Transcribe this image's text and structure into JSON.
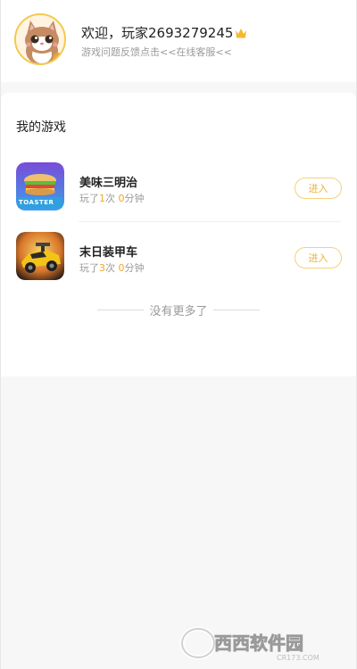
{
  "user": {
    "welcome_text": "欢迎，玩家2693279245",
    "feedback_text": "游戏问题反馈点击<<在线客服<<"
  },
  "my_games": {
    "title": "我的游戏",
    "items": [
      {
        "name": "美味三明治",
        "played_prefix": "玩了",
        "played_count": "1",
        "played_unit": "次",
        "minutes": "0",
        "minutes_unit": "分钟",
        "enter_label": "进入",
        "icon_text": "TOASTER"
      },
      {
        "name": "末日装甲车",
        "played_prefix": "玩了",
        "played_count": "3",
        "played_unit": "次",
        "minutes": "0",
        "minutes_unit": "分钟",
        "enter_label": "进入"
      }
    ],
    "no_more_text": "没有更多了"
  },
  "watermark": {
    "brand": "西西软件园",
    "domain": "CR173.COM"
  },
  "colors": {
    "accent": "#f5a623",
    "button_border": "#f3d27a",
    "background": "#f7f7f7"
  }
}
